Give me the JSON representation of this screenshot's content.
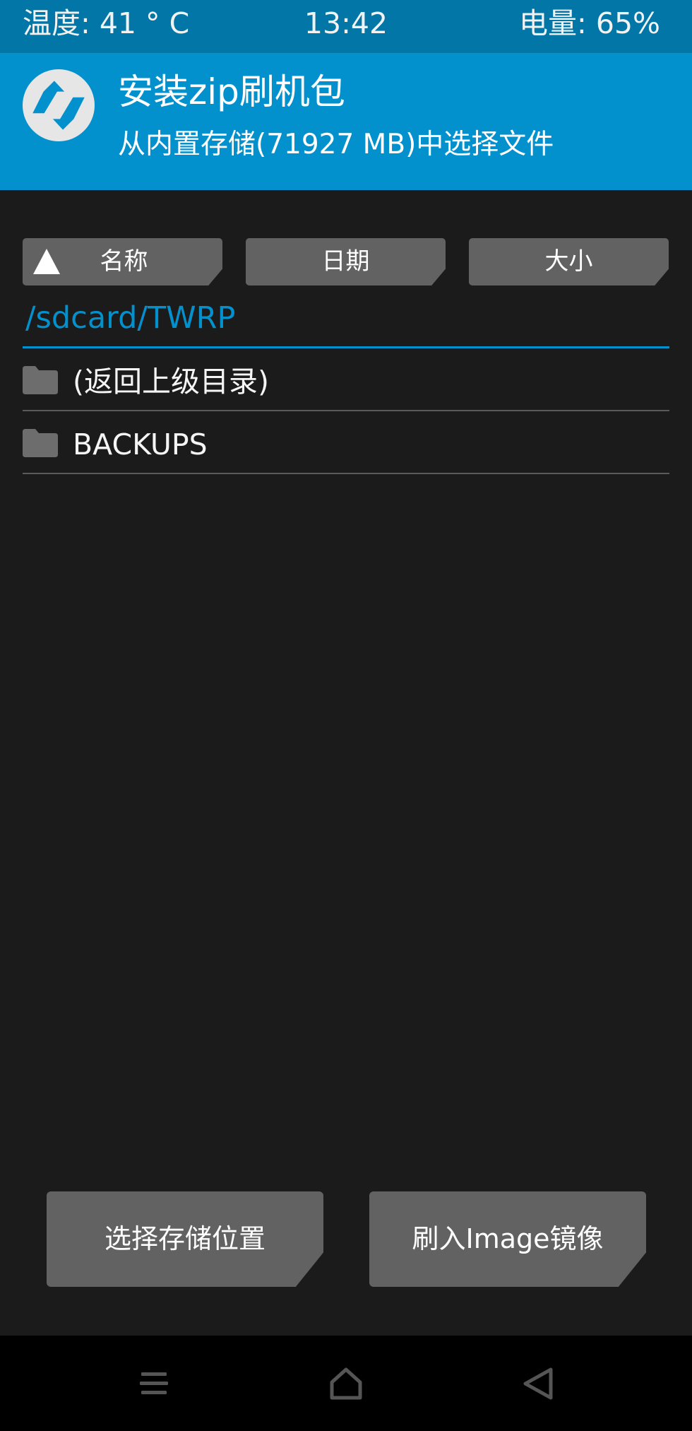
{
  "status_bar": {
    "temperature": "温度: 41 ° C",
    "time": "13:42",
    "battery": "电量: 65%"
  },
  "header": {
    "title": "安装zip刷机包",
    "subtitle": "从内置存储(71927 MB)中选择文件",
    "logo_icon": "twrp-logo-icon"
  },
  "sort_buttons": {
    "name": "名称",
    "date": "日期",
    "size": "大小",
    "active_icon": "sort-ascending-triangle-icon"
  },
  "current_path": "/sdcard/TWRP",
  "file_list": [
    {
      "label": "(返回上级目录)",
      "icon": "folder-icon"
    },
    {
      "label": "BACKUPS",
      "icon": "folder-icon"
    }
  ],
  "actions": {
    "select_storage": "选择存储位置",
    "flash_image": "刷入Image镜像"
  },
  "nav_bar": {
    "menu_icon": "menu-icon",
    "home_icon": "home-icon",
    "back_icon": "back-icon"
  },
  "colors": {
    "status_bar_bg": "#0276a6",
    "header_bg": "#0391ce",
    "accent": "#0391ce",
    "background": "#1b1b1b",
    "button_bg": "#626262",
    "nav_bar_bg": "#000000"
  }
}
